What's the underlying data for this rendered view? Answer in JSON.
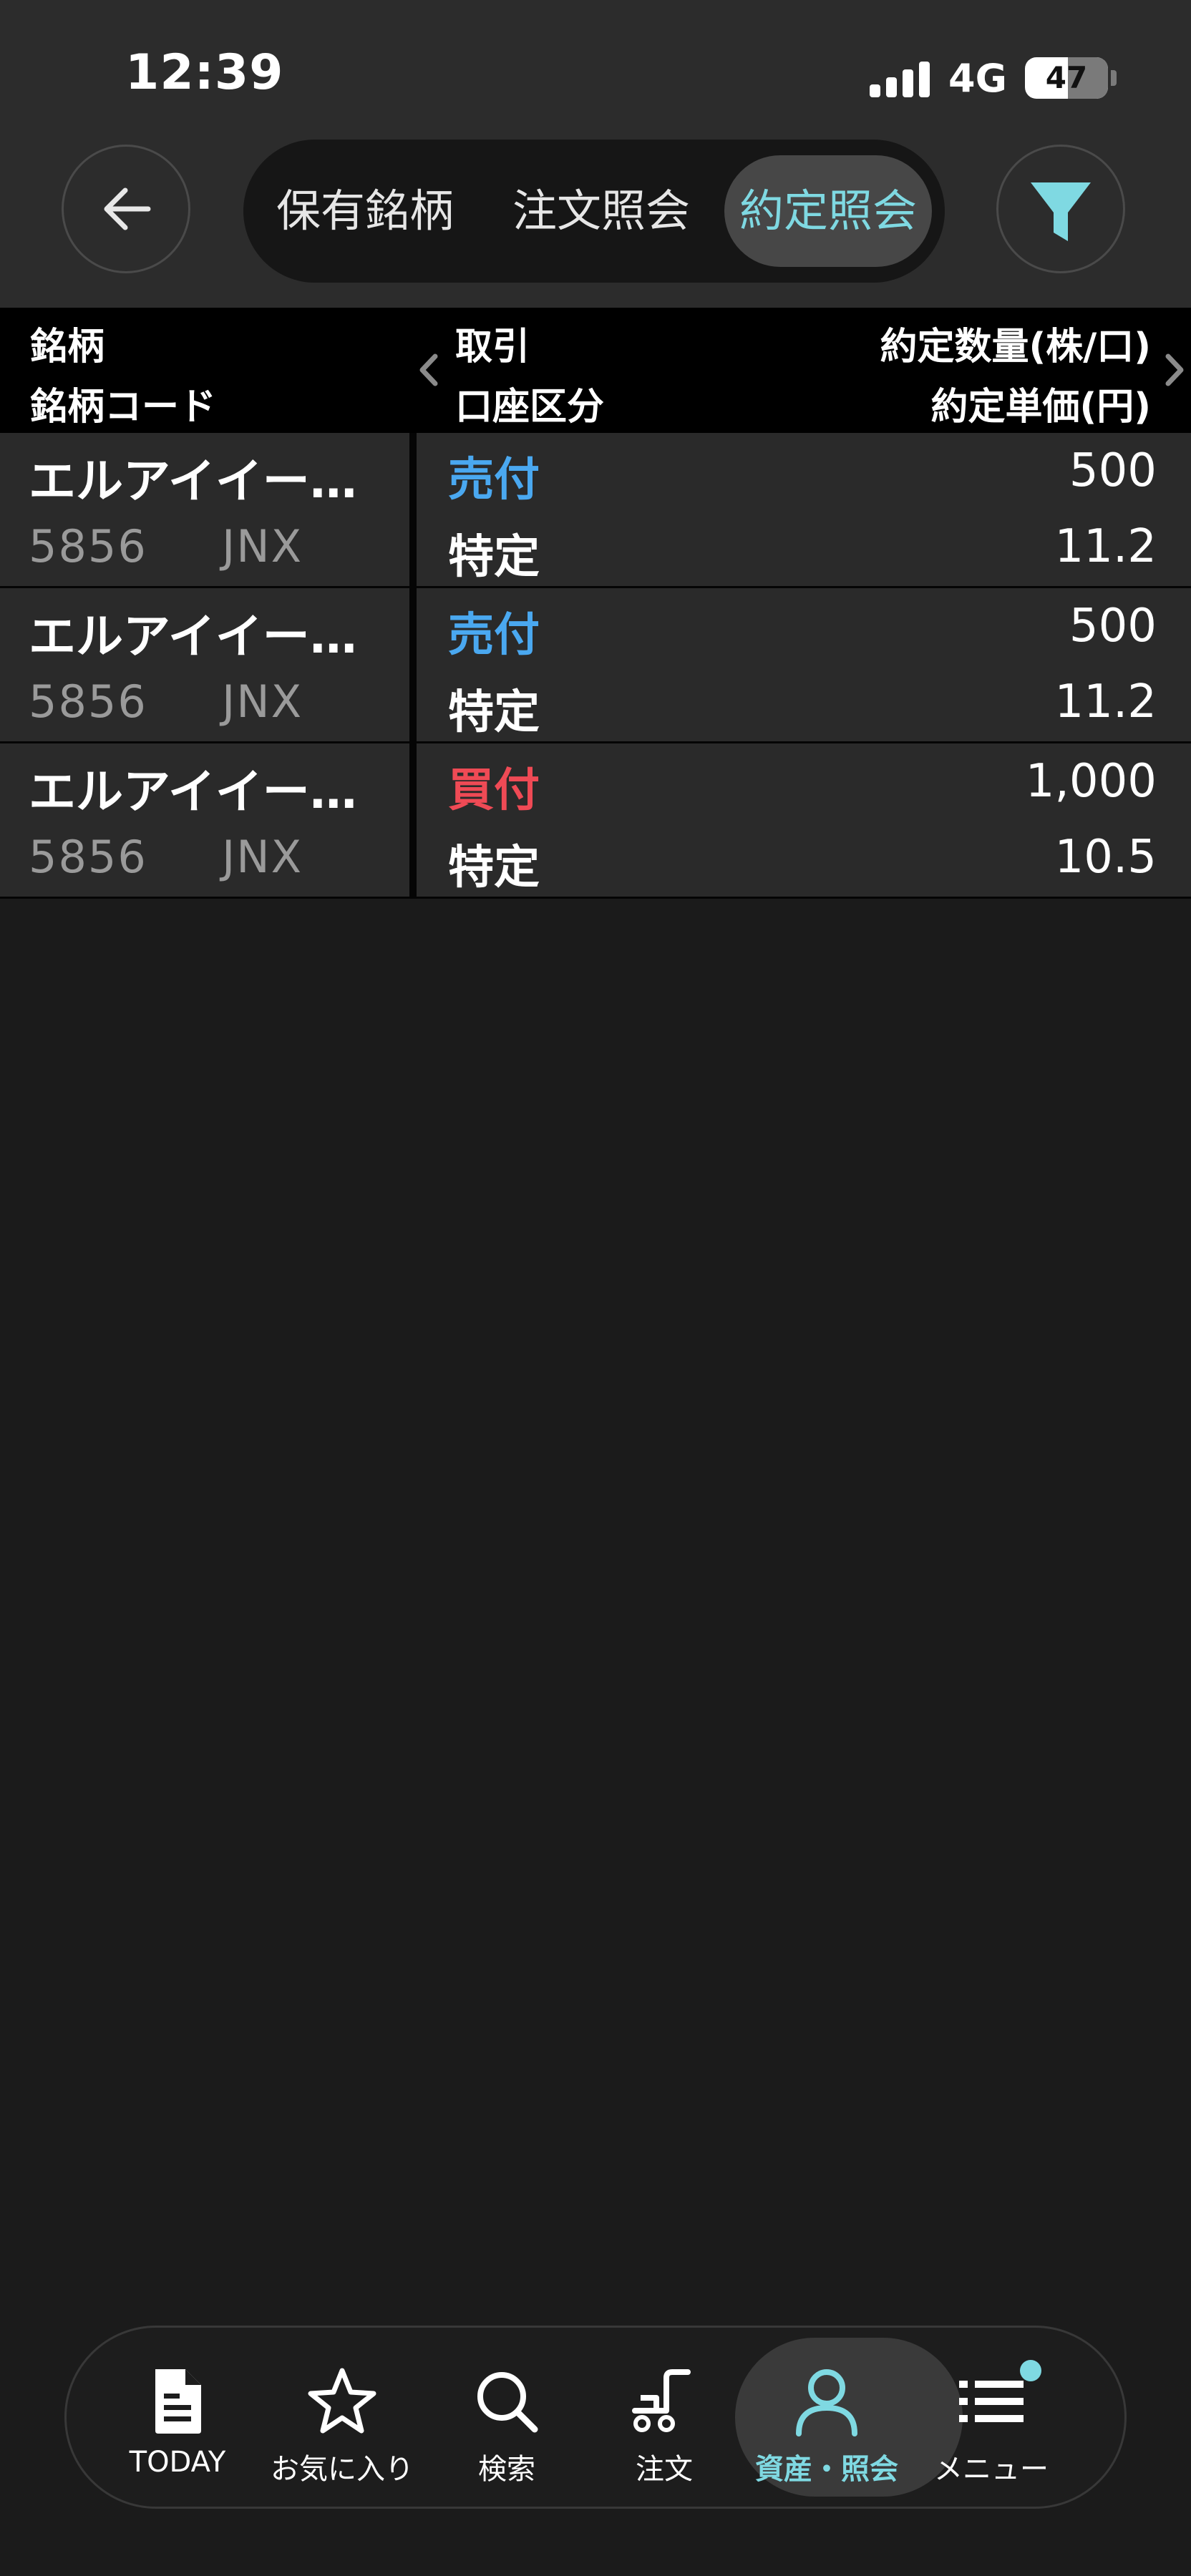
{
  "status_bar": {
    "time": "12:39",
    "network": "4G",
    "battery": "47"
  },
  "header": {
    "tabs": [
      {
        "label": "保有銘柄",
        "active": false
      },
      {
        "label": "注文照会",
        "active": false
      },
      {
        "label": "約定照会",
        "active": true
      }
    ],
    "back_icon": "arrow-left-icon",
    "filter_icon": "filter-icon"
  },
  "table": {
    "headers": {
      "col1_line1": "銘柄",
      "col1_line2": "銘柄コード",
      "col2_line1": "取引",
      "col2_line2": "口座区分",
      "col3_line1": "約定数量(株/口)",
      "col3_line2": "約定単価(円)"
    },
    "rows": [
      {
        "name": "エルアイイー…",
        "code": "5856",
        "market": "JNX",
        "trade": "売付",
        "trade_color": "#4aa8f0",
        "account": "特定",
        "quantity": "500",
        "price": "11.2"
      },
      {
        "name": "エルアイイー…",
        "code": "5856",
        "market": "JNX",
        "trade": "売付",
        "trade_color": "#4aa8f0",
        "account": "特定",
        "quantity": "500",
        "price": "11.2"
      },
      {
        "name": "エルアイイー…",
        "code": "5856",
        "market": "JNX",
        "trade": "買付",
        "trade_color": "#ef4a55",
        "account": "特定",
        "quantity": "1,000",
        "price": "10.5"
      }
    ]
  },
  "bottom_nav": {
    "items": [
      {
        "label": "TODAY",
        "icon": "document-icon",
        "active": false
      },
      {
        "label": "お気に入り",
        "icon": "star-icon",
        "active": false
      },
      {
        "label": "検索",
        "icon": "search-icon",
        "active": false
      },
      {
        "label": "注文",
        "icon": "cart-icon",
        "active": false
      },
      {
        "label": "資産・照会",
        "icon": "person-icon",
        "active": true
      },
      {
        "label": "メニュー",
        "icon": "menu-icon",
        "active": false
      }
    ]
  },
  "colors": {
    "accent": "#7fd9e2",
    "sell": "#4aa8f0",
    "buy": "#ef4a55"
  }
}
